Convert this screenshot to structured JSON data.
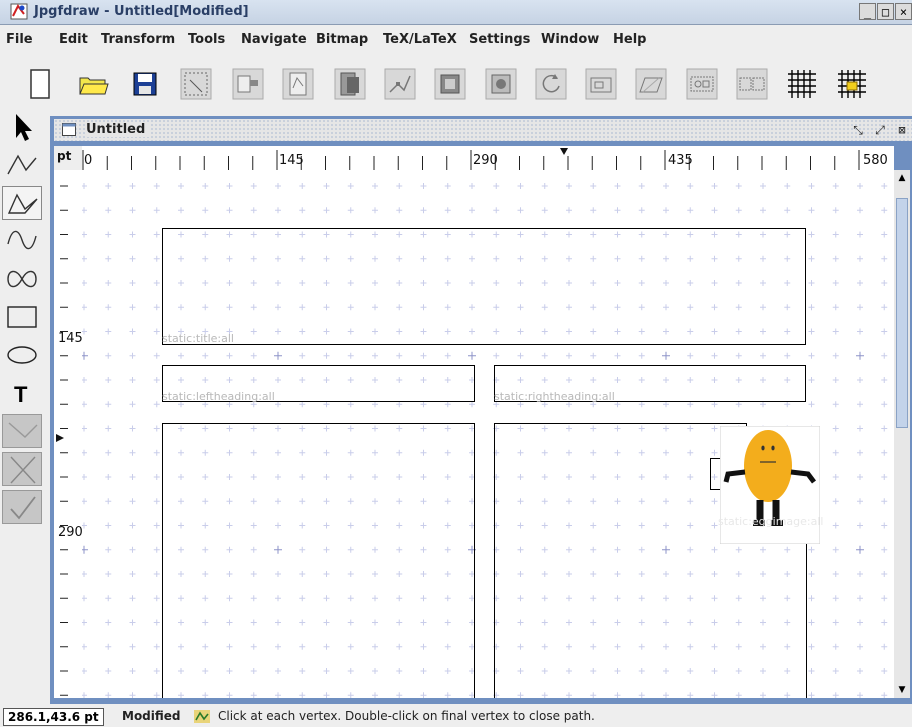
{
  "window": {
    "title": "Jpgfdraw - Untitled[Modified]",
    "controls": [
      "_",
      "□",
      "×"
    ]
  },
  "menubar": {
    "items": [
      "File",
      "Edit",
      "Transform",
      "Tools",
      "Navigate",
      "Bitmap",
      "TeX/LaTeX",
      "Settings",
      "Window",
      "Help"
    ]
  },
  "toolbar": {
    "buttons": [
      {
        "name": "new-icon"
      },
      {
        "name": "open-folder-icon"
      },
      {
        "name": "save-icon"
      },
      {
        "name": "select-region-icon"
      },
      {
        "name": "pick-bitmap-icon"
      },
      {
        "name": "path-properties-icon"
      },
      {
        "name": "bring-front-icon"
      },
      {
        "name": "edit-path-icon"
      },
      {
        "name": "grid-snap-icon"
      },
      {
        "name": "clip-icon"
      },
      {
        "name": "rotate-icon"
      },
      {
        "name": "scale-icon"
      },
      {
        "name": "shear-icon"
      },
      {
        "name": "group-icon"
      },
      {
        "name": "ungroup-icon"
      },
      {
        "name": "show-grid-icon"
      },
      {
        "name": "lock-grid-icon"
      }
    ]
  },
  "left_tools": [
    {
      "name": "select-tool-icon"
    },
    {
      "name": "open-line-tool-icon"
    },
    {
      "name": "closed-line-tool-icon"
    },
    {
      "name": "open-curve-tool-icon"
    },
    {
      "name": "closed-curve-tool-icon"
    },
    {
      "name": "rectangle-tool-icon"
    },
    {
      "name": "ellipse-tool-icon"
    },
    {
      "name": "text-tool-icon"
    },
    {
      "name": "gradient-tool-icon"
    },
    {
      "name": "abandon-path-icon"
    },
    {
      "name": "finish-path-icon"
    }
  ],
  "document": {
    "title": "Untitled",
    "controls": [
      "⤡",
      "⤢",
      "⊠"
    ],
    "unit": "pt",
    "h_ruler_labels": [
      "0",
      "145",
      "290",
      "435",
      "580"
    ],
    "v_ruler_labels": [
      "145",
      "290"
    ],
    "region_labels": [
      "static:title:all",
      "static:leftheading:all",
      "static:rightheading:all",
      "static:eggimage:all"
    ]
  },
  "status": {
    "coords": "286.1,43.6 pt",
    "modified": "Modified",
    "message": "Click at each vertex. Double-click on final vertex to close path."
  },
  "colors": {
    "frame_border": "#6f8fc0",
    "grid_minor": "#c9cdea",
    "egg": "#f3ad1c"
  }
}
